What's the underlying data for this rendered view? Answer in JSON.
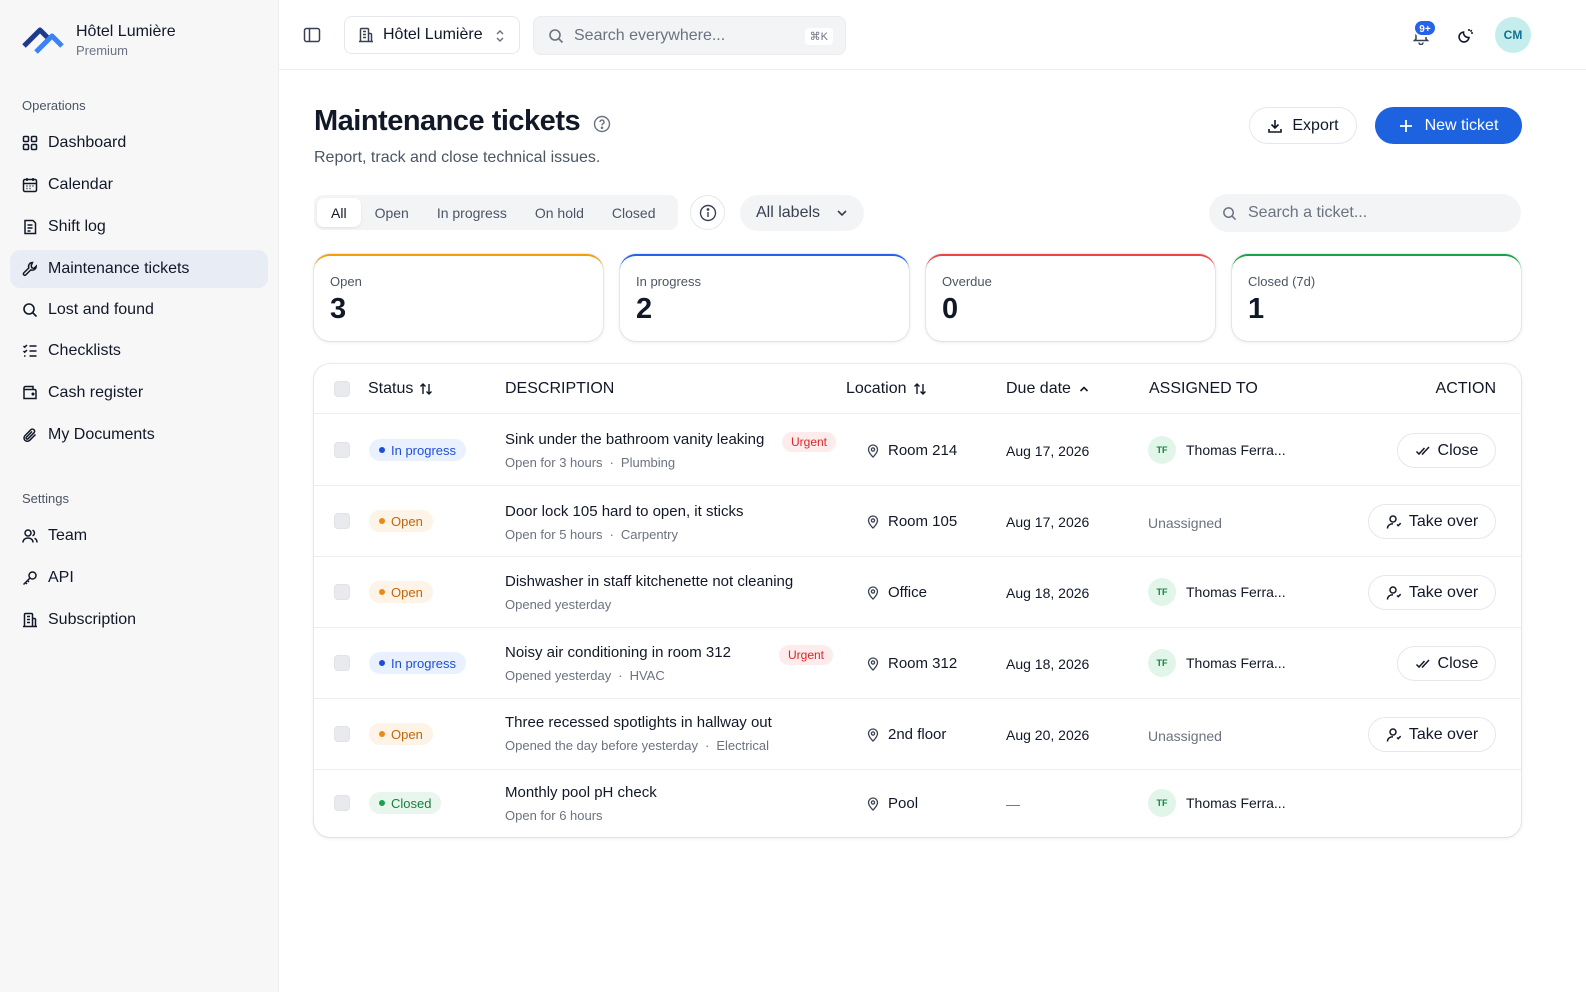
{
  "brand": {
    "name": "Hôtel Lumière",
    "plan": "Premium"
  },
  "sidebar": {
    "section_ops": "Operations",
    "ops_items": [
      {
        "label": "Dashboard",
        "icon": "dashboard-icon"
      },
      {
        "label": "Calendar",
        "icon": "calendar-icon"
      },
      {
        "label": "Shift log",
        "icon": "shift-log-icon"
      },
      {
        "label": "Maintenance tickets",
        "icon": "wrench-icon",
        "active": true
      },
      {
        "label": "Lost and found",
        "icon": "search-icon"
      },
      {
        "label": "Checklists",
        "icon": "checklist-icon"
      },
      {
        "label": "Cash register",
        "icon": "cash-register-icon"
      },
      {
        "label": "My Documents",
        "icon": "paperclip-icon"
      }
    ],
    "section_settings": "Settings",
    "settings_items": [
      {
        "label": "Team",
        "icon": "team-icon"
      },
      {
        "label": "API",
        "icon": "key-icon"
      },
      {
        "label": "Subscription",
        "icon": "building-icon"
      }
    ]
  },
  "topbar": {
    "hotel": "Hôtel Lumière",
    "search_placeholder": "Search everywhere...",
    "search_shortcut": "⌘K",
    "notifications_badge": "9+",
    "user_initials": "CM"
  },
  "page": {
    "title": "Maintenance tickets",
    "subtitle": "Report, track and close technical issues.",
    "export_label": "Export",
    "new_label": "New ticket"
  },
  "filters": {
    "tabs": [
      "All",
      "Open",
      "In progress",
      "On hold",
      "Closed"
    ],
    "active_tab": "All",
    "labels_select": "All labels",
    "search_placeholder": "Search a ticket..."
  },
  "stats": [
    {
      "label": "Open",
      "value": "3",
      "color": "#f59e0b"
    },
    {
      "label": "In progress",
      "value": "2",
      "color": "#2563eb"
    },
    {
      "label": "Overdue",
      "value": "0",
      "color": "#ef4444"
    },
    {
      "label": "Closed (7d)",
      "value": "1",
      "color": "#16a34a"
    }
  ],
  "table": {
    "headers": {
      "status": "Status",
      "description": "DESCRIPTION",
      "location": "Location",
      "due": "Due date",
      "assigned": "ASSIGNED TO",
      "action": "ACTION"
    },
    "rows": [
      {
        "status": "In progress",
        "status_kind": "progress",
        "title": "Sink under the bathroom vanity leaking",
        "urgent": "Urgent",
        "meta1": "Open for 3 hours",
        "meta2": "Plumbing",
        "location": "Room 214",
        "due": "Aug 17, 2026",
        "assignee_initials": "TF",
        "assignee": "Thomas Ferra...",
        "action": "Close"
      },
      {
        "status": "Open",
        "status_kind": "open",
        "title": "Door lock 105 hard to open, it sticks",
        "urgent": "",
        "meta1": "Open for 5 hours",
        "meta2": "Carpentry",
        "location": "Room 105",
        "due": "Aug 17, 2026",
        "assignee_initials": "",
        "assignee": "Unassigned",
        "action": "Take over"
      },
      {
        "status": "Open",
        "status_kind": "open",
        "title": "Dishwasher in staff kitchenette not cleaning",
        "urgent": "",
        "meta1": "Opened yesterday",
        "meta2": "",
        "location": "Office",
        "due": "Aug 18, 2026",
        "assignee_initials": "TF",
        "assignee": "Thomas Ferra...",
        "action": "Take over"
      },
      {
        "status": "In progress",
        "status_kind": "progress",
        "title": "Noisy air conditioning in room 312",
        "urgent": "Urgent",
        "meta1": "Opened yesterday",
        "meta2": "HVAC",
        "location": "Room 312",
        "due": "Aug 18, 2026",
        "assignee_initials": "TF",
        "assignee": "Thomas Ferra...",
        "action": "Close"
      },
      {
        "status": "Open",
        "status_kind": "open",
        "title": "Three recessed spotlights in hallway out",
        "urgent": "",
        "meta1": "Opened the day before yesterday",
        "meta2": "Electrical",
        "location": "2nd floor",
        "due": "Aug 20, 2026",
        "assignee_initials": "",
        "assignee": "Unassigned",
        "action": "Take over"
      },
      {
        "status": "Closed",
        "status_kind": "closed",
        "title": "Monthly pool pH check",
        "urgent": "",
        "meta1": "Open for 6 hours",
        "meta2": "",
        "location": "Pool",
        "due": "—",
        "assignee_initials": "TF",
        "assignee": "Thomas Ferra...",
        "action": ""
      }
    ]
  }
}
